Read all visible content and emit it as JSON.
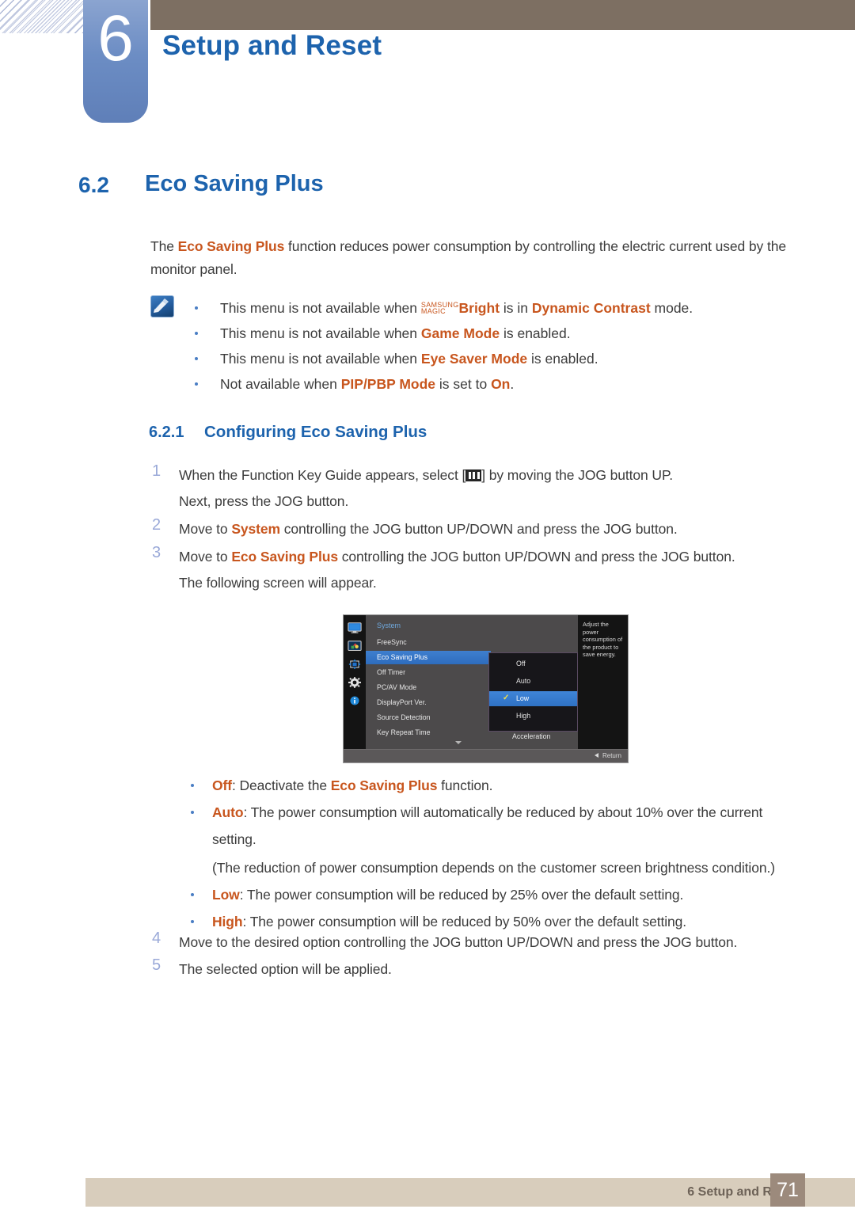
{
  "header": {
    "chapter_number": "6",
    "chapter_title": "Setup and Reset"
  },
  "section": {
    "number": "6.2",
    "title": "Eco Saving Plus"
  },
  "intro": {
    "part1": "The ",
    "highlight": "Eco Saving Plus",
    "part2": " function reduces power consumption by controlling the electric current used by the monitor panel."
  },
  "notes": {
    "icon_name": "note-pencil-icon",
    "items": [
      {
        "pre": "This menu is not available when ",
        "magic_line1": "SAMSUNG",
        "magic_line2": "MAGIC",
        "bold1": "Bright",
        "mid": " is in ",
        "bold2": "Dynamic Contrast",
        "post": " mode."
      },
      {
        "pre": "This menu is not available when ",
        "bold1": "Game Mode",
        "post": " is enabled."
      },
      {
        "pre": "This menu is not available when ",
        "bold1": "Eye Saver Mode",
        "post": " is enabled."
      },
      {
        "pre": "Not available when ",
        "bold1": "PIP/PBP Mode",
        "mid": " is set to ",
        "bold2": "On",
        "post": "."
      }
    ]
  },
  "subsection": {
    "number": "6.2.1",
    "title": "Configuring Eco Saving Plus"
  },
  "steps": [
    {
      "num": "1",
      "pre": "When the Function Key Guide appears, select [",
      "icon": "jog-button-icon",
      "post": "] by moving the JOG button UP.",
      "line2": "Next, press the JOG button."
    },
    {
      "num": "2",
      "pre": "Move to ",
      "bold": "System",
      "post": " controlling the JOG button UP/DOWN and press the JOG button."
    },
    {
      "num": "3",
      "pre": "Move to ",
      "bold": "Eco Saving Plus",
      "post": " controlling the JOG button UP/DOWN and press the JOG button.",
      "line2": "The following screen will appear."
    },
    {
      "num": "4",
      "pre": "Move to the desired option controlling the JOG button UP/DOWN and press the JOG button."
    },
    {
      "num": "5",
      "pre": "The selected option will be applied."
    }
  ],
  "osd": {
    "title": "System",
    "rail_icons": [
      "display-monitor-icon",
      "picture-color-icon",
      "pip-arrows-icon",
      "system-gear-icon",
      "information-icon"
    ],
    "menu_items": [
      {
        "label": "FreeSync",
        "selected": false
      },
      {
        "label": "Eco Saving Plus",
        "selected": true
      },
      {
        "label": "Off Timer",
        "selected": false
      },
      {
        "label": "PC/AV Mode",
        "selected": false
      },
      {
        "label": "DisplayPort Ver.",
        "selected": false
      },
      {
        "label": "Source Detection",
        "selected": false
      },
      {
        "label": "Key Repeat Time",
        "selected": false
      }
    ],
    "sub_items": [
      {
        "label": "Off",
        "selected": false,
        "check": ""
      },
      {
        "label": "Auto",
        "selected": false,
        "check": ""
      },
      {
        "label": "Low",
        "selected": true,
        "check": "✓"
      },
      {
        "label": "High",
        "selected": false,
        "check": ""
      }
    ],
    "acceleration_label": "Acceleration",
    "description": "Adjust the power consumption of the product to save energy.",
    "return_label": "Return"
  },
  "options": [
    {
      "bold": "Off",
      "pre": ": Deactivate the ",
      "bold2": "Eco Saving Plus",
      "post": " function."
    },
    {
      "bold": "Auto",
      "pre": ": The power consumption will automatically be reduced by about 10% over the current setting.",
      "extra": "(The reduction of power consumption depends on the customer screen brightness condition.)"
    },
    {
      "bold": "Low",
      "pre": ": The power consumption will be reduced by 25% over the default setting."
    },
    {
      "bold": "High",
      "pre": ": The power consumption will be reduced by 50% over the default setting."
    }
  ],
  "footer": {
    "text": "6 Setup and Reset",
    "page": "71"
  },
  "colors": {
    "accent_blue": "#1d63ad",
    "accent_orange": "#c8561e",
    "header_brown": "#7d6f62",
    "footer_tan": "#d8cdbc",
    "page_box": "#9c8a7c"
  }
}
